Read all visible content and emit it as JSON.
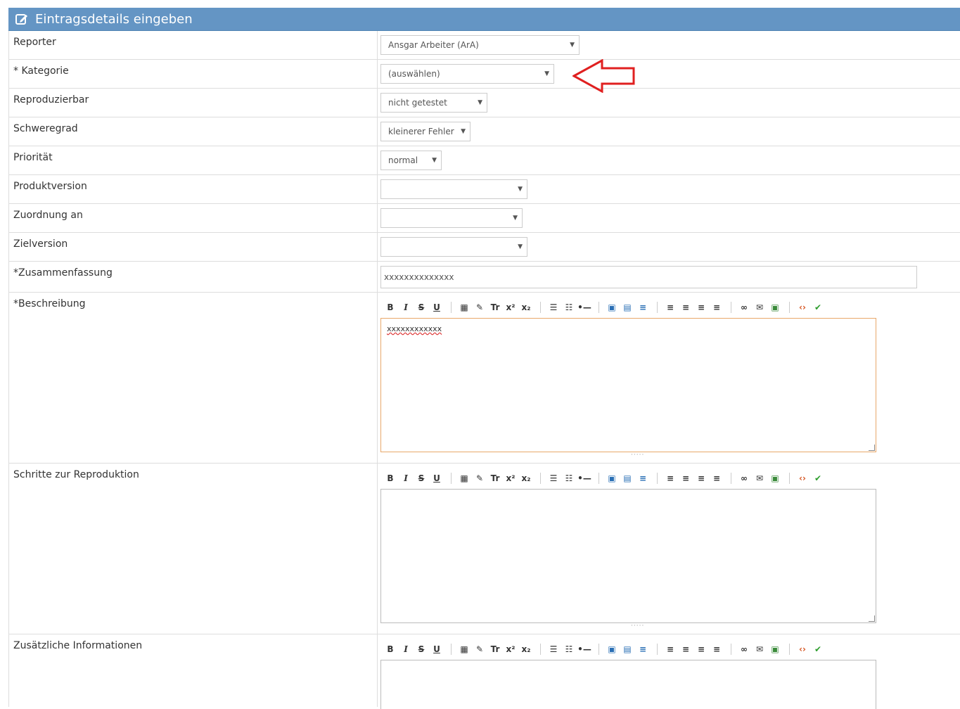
{
  "header": {
    "title": "Eintragsdetails eingeben",
    "icon": "edit-icon"
  },
  "fields": {
    "reporter": {
      "label": "Reporter",
      "value": "Ansgar Arbeiter (ArA)"
    },
    "kategorie": {
      "label": "* Kategorie",
      "value": "(auswählen)"
    },
    "reproduzierbar": {
      "label": "Reproduzierbar",
      "value": "nicht getestet"
    },
    "schweregrad": {
      "label": "Schweregrad",
      "value": "kleinerer Fehler"
    },
    "prioritaet": {
      "label": "Priorität",
      "value": "normal"
    },
    "produktversion": {
      "label": "Produktversion",
      "value": ""
    },
    "zuordnung": {
      "label": "Zuordnung an",
      "value": ""
    },
    "zielversion": {
      "label": "Zielversion",
      "value": ""
    },
    "zusammenfassung": {
      "label": "*Zusammenfassung",
      "value": "xxxxxxxxxxxxxx"
    },
    "beschreibung": {
      "label": "*Beschreibung",
      "value": "xxxxxxxxxxxx"
    },
    "schritte": {
      "label": "Schritte zur Reproduktion",
      "value": ""
    },
    "zusaetzlich": {
      "label": "Zusätzliche Informationen",
      "value": ""
    }
  },
  "toolbar": {
    "bold": "B",
    "italic": "I",
    "strike": "S",
    "underline": "U",
    "removeformat": "Tr",
    "superscript": "x²",
    "subscript": "x₂"
  },
  "colors": {
    "header": "#6495c4",
    "arrow": "#e02020",
    "editor_focus": "#e8a86a"
  }
}
